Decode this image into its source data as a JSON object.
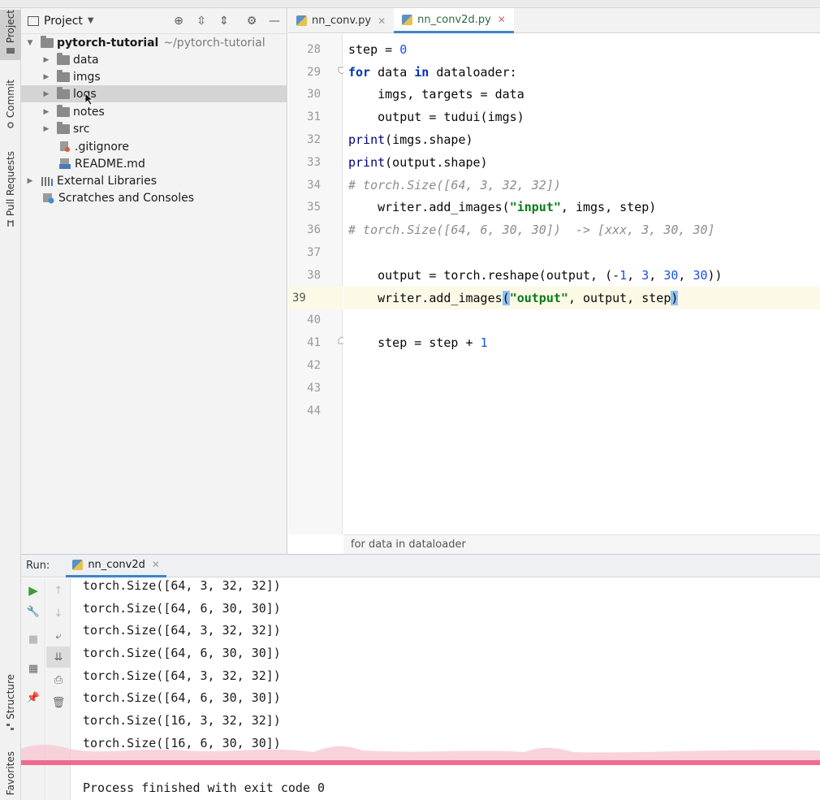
{
  "stripe": {
    "project_label": "Project",
    "commit_label": "Commit",
    "pull_label": "Pull Requests",
    "structure_label": "Structure",
    "favorites_label": "Favorites"
  },
  "project": {
    "title": "Project",
    "root": {
      "name": "pytorch-tutorial",
      "path": "~/pytorch-tutorial"
    },
    "folders": [
      "data",
      "imgs",
      "logs",
      "notes",
      "src"
    ],
    "files": [
      ".gitignore",
      "README.md"
    ],
    "external": "External Libraries",
    "scratches": "Scratches and Consoles",
    "selected": "logs"
  },
  "editor": {
    "tabs": [
      {
        "label": "nn_conv.py",
        "active": false
      },
      {
        "label": "nn_conv2d.py",
        "active": true
      }
    ],
    "line_numbers": [
      "28",
      "29",
      "30",
      "31",
      "32",
      "33",
      "34",
      "35",
      "36",
      "37",
      "38",
      "39",
      "40",
      "41",
      "42",
      "43",
      "44"
    ],
    "current_line": "39",
    "breadcrumb": "for data in dataloader"
  },
  "run": {
    "label": "Run:",
    "tab": "nn_conv2d",
    "output": [
      "torch.Size([64, 3, 32, 32])",
      "torch.Size([64, 6, 30, 30])",
      "torch.Size([64, 3, 32, 32])",
      "torch.Size([64, 6, 30, 30])",
      "torch.Size([64, 3, 32, 32])",
      "torch.Size([64, 6, 30, 30])",
      "torch.Size([16, 3, 32, 32])",
      "torch.Size([16, 6, 30, 30])",
      "",
      "Process finished with exit code 0"
    ]
  },
  "colors": {
    "keyword": "#0033b3",
    "number": "#1750eb",
    "string": "#067d17",
    "comment": "#8c8c8c",
    "accent": "#4083c9",
    "video_progress": "#f06b8f"
  }
}
